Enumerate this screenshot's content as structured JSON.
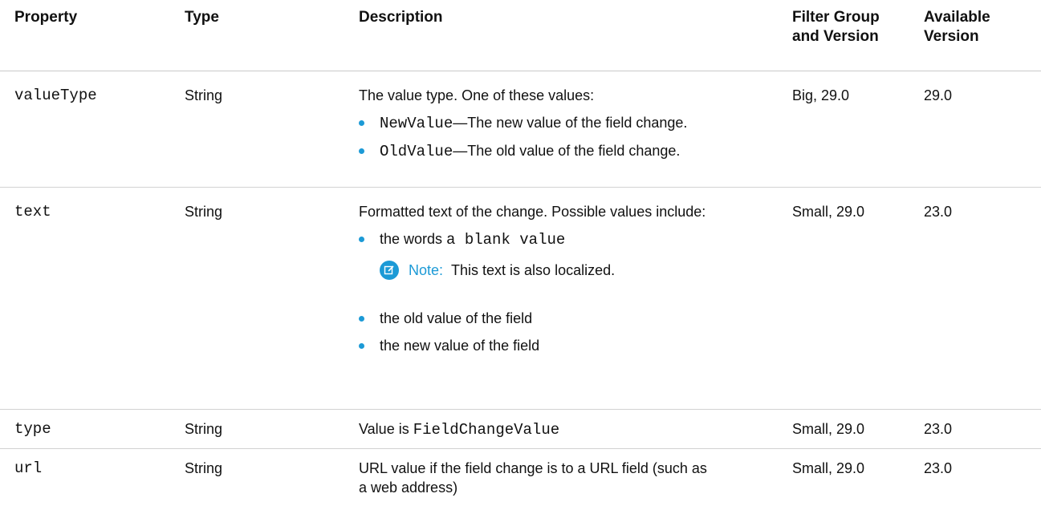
{
  "header": {
    "property": "Property",
    "type": "Type",
    "description": "Description",
    "filter_line1": "Filter Group",
    "filter_line2": "and Version",
    "available_line1": "Available",
    "available_line2": "Version"
  },
  "rows": [
    {
      "property": "valueType",
      "type": "String",
      "desc_intro": "The value type. One of these values:",
      "bullets": [
        {
          "code": "NewValue",
          "text": "—The new value of the field change."
        },
        {
          "code": "OldValue",
          "text": "—The old value of the field change."
        }
      ],
      "filter": "Big, 29.0",
      "available": "29.0"
    },
    {
      "property": "text",
      "type": "String",
      "desc_intro": "Formatted text of the change. Possible values include:",
      "bullet1_prefix": "the words ",
      "bullet1_code": "a blank value",
      "note_label": "Note:",
      "note_text": "This text is also localized.",
      "bullet2": "the old value of the field",
      "bullet3": "the new value of the field",
      "filter": "Small, 29.0",
      "available": "23.0"
    },
    {
      "property": "type",
      "type": "String",
      "desc_prefix": "Value is ",
      "desc_code": "FieldChangeValue",
      "filter": "Small, 29.0",
      "available": "23.0"
    },
    {
      "property": "url",
      "type": "String",
      "desc_line1": "URL value if the field change is to a URL field (such as",
      "desc_line2": "a web address)",
      "filter": "Small, 29.0",
      "available": "23.0"
    }
  ],
  "colors": {
    "accent": "#1c9ad6",
    "divider": "#d2d2d2"
  },
  "icons": {
    "note": "edit-note-icon",
    "bullet": "bullet-dot-icon"
  }
}
